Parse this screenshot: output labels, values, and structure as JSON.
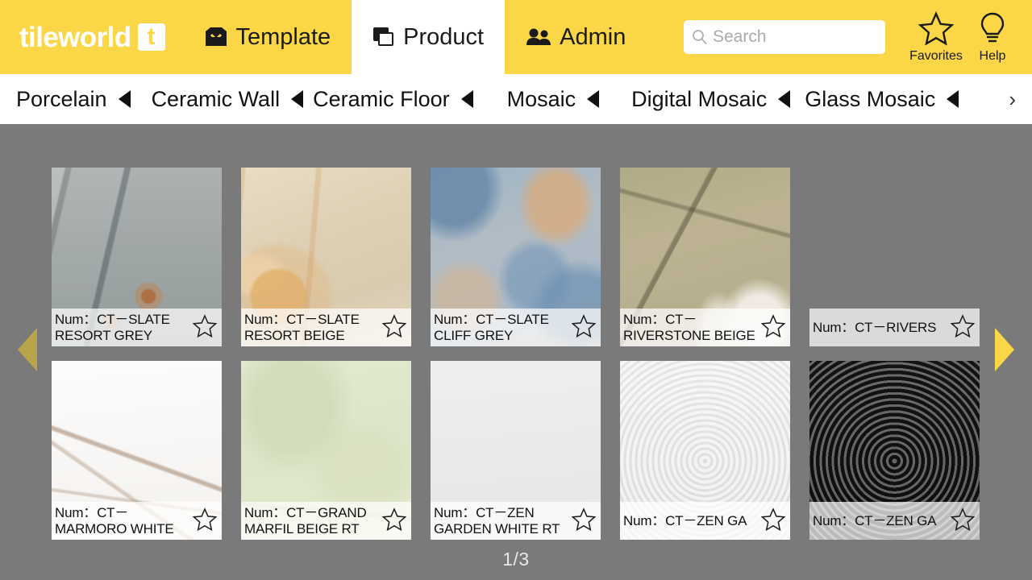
{
  "header": {
    "brand": {
      "word": "tileworld",
      "mark_letter": "t"
    },
    "tabs": [
      {
        "label": "Template",
        "icon": "inbox-icon",
        "active": false
      },
      {
        "label": "Product",
        "icon": "copy-icon",
        "active": true
      },
      {
        "label": "Admin",
        "icon": "users-icon",
        "active": false
      }
    ],
    "search": {
      "value": "",
      "placeholder": "Search",
      "icon": "search-icon"
    },
    "actions": [
      {
        "label": "Favorites",
        "icon": "star-icon"
      },
      {
        "label": "Help",
        "icon": "lightbulb-icon"
      }
    ]
  },
  "categories": {
    "items": [
      {
        "label": "Porcelain",
        "icon": "triangle-left-icon"
      },
      {
        "label": "Ceramic Wall",
        "icon": "triangle-left-icon"
      },
      {
        "label": "Ceramic Floor",
        "icon": "triangle-left-icon"
      },
      {
        "label": "Mosaic",
        "icon": "triangle-left-icon"
      },
      {
        "label": "Digital Mosaic",
        "icon": "triangle-left-icon"
      },
      {
        "label": "Glass Mosaic",
        "icon": "triangle-left-icon"
      }
    ],
    "more": "›"
  },
  "products": [
    {
      "num_line1": "Num：CT－SLATE",
      "num_line2": "RESORT GREY",
      "texture": "slate-resort-grey"
    },
    {
      "num_line1": "Num：CT－SLATE",
      "num_line2": "RESORT BEIGE",
      "texture": "slate-resort-beige"
    },
    {
      "num_line1": "Num：CT－SLATE",
      "num_line2": "CLIFF GREY",
      "texture": "slate-cliff-grey"
    },
    {
      "num_line1": "Num：CT－",
      "num_line2": "RIVERSTONE BEIGE",
      "texture": "riverstone-beige"
    },
    {
      "num_line1": "Num：CT－RIVERS",
      "num_line2": "",
      "texture": "rivers"
    },
    {
      "num_line1": "Num：CT－",
      "num_line2": "MARMORO WHITE",
      "texture": "marmoro-white"
    },
    {
      "num_line1": "Num：CT－GRAND",
      "num_line2": "MARFIL BEIGE RT",
      "texture": "grand-marfil-beige"
    },
    {
      "num_line1": "Num：CT－ZEN",
      "num_line2": "GARDEN WHITE RT",
      "texture": "zen-garden-white"
    },
    {
      "num_line1": "Num：CT－ZEN GA",
      "num_line2": "",
      "texture": "zen-ga-light"
    },
    {
      "num_line1": "Num：CT－ZEN GA",
      "num_line2": "",
      "texture": "zen-ga-dark"
    }
  ],
  "nav": {
    "prev_icon": "triangle-left-icon",
    "next_icon": "triangle-right-icon",
    "page_indicator": "1/3"
  },
  "colors": {
    "brand_yellow": "#FBD646",
    "stage_grey": "#7a7a7a",
    "arrow_prev": "#b8a44a",
    "arrow_next": "#FBD646"
  }
}
